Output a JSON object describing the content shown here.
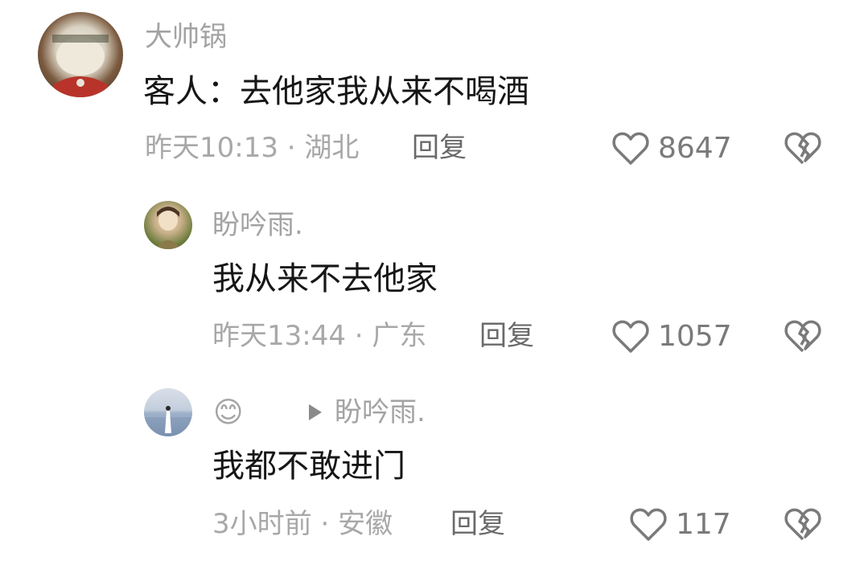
{
  "comments": [
    {
      "username": "大帅锅",
      "text": "客人：去他家我从来不喝酒",
      "time": "昨天10:13",
      "location": "湖北",
      "reply_label": "回复",
      "likes": "8647"
    },
    {
      "username": "盼吟雨.",
      "text": "我从来不去他家",
      "time": "昨天13:44",
      "location": "广东",
      "reply_label": "回复",
      "likes": "1057"
    },
    {
      "username_emoji": "😊",
      "reply_to": "盼吟雨.",
      "text": "我都不敢进门",
      "time": "3小时前",
      "location": "安徽",
      "reply_label": "回复",
      "likes": "117"
    }
  ],
  "separator": "·",
  "icons": {
    "like": "heart-outline-icon",
    "dislike": "broken-heart-icon",
    "reply_arrow": "play-arrow-icon"
  }
}
